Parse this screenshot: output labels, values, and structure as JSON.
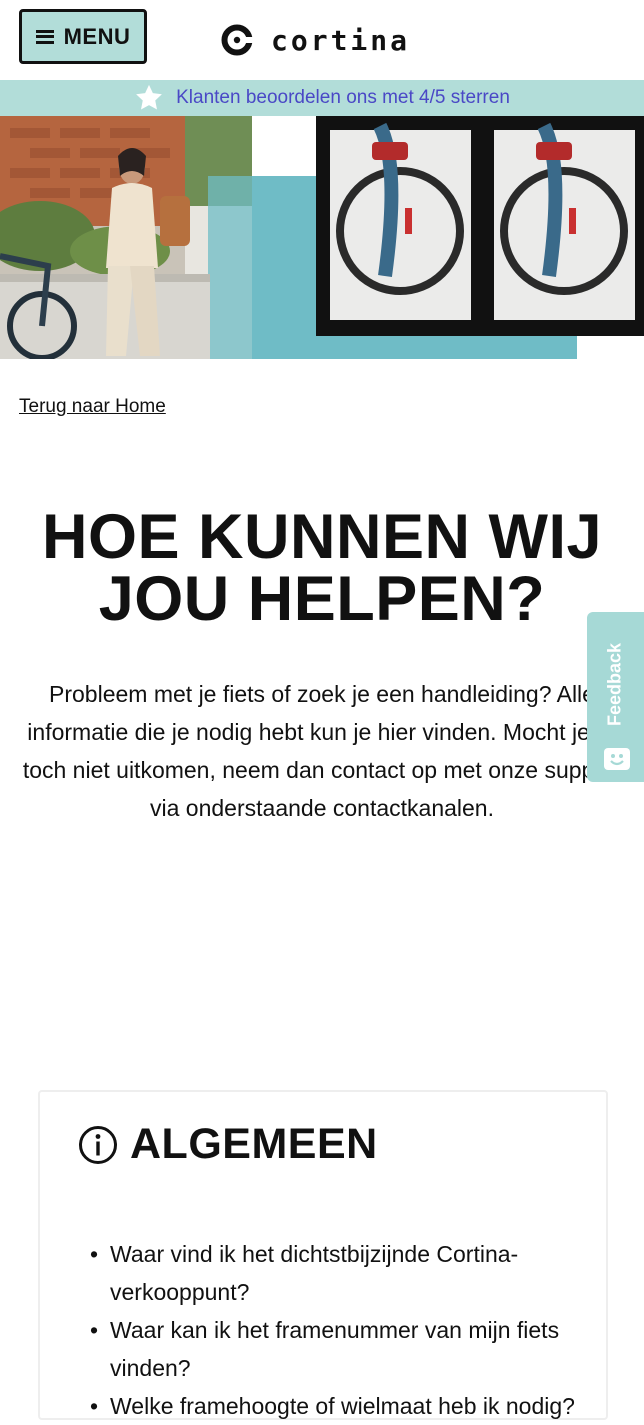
{
  "header": {
    "menu_label": "MENU",
    "logo_text": "cortina"
  },
  "rating": {
    "text": "Klanten beoordelen ons met 4/5 sterren",
    "icon": "star-icon"
  },
  "breadcrumb": {
    "back_label": "Terug naar Home"
  },
  "main": {
    "title_line1": "HOE KUNNEN WIJ",
    "title_line2": "JOU HELPEN?",
    "intro": "Probleem met je fiets of zoek je een handleiding? Alle informatie die je nodig hebt kun je hier vinden. Mocht je er toch niet uitkomen, neem dan contact op met onze support via onderstaande contactkanalen."
  },
  "feedback_tab": {
    "label": "Feedback"
  },
  "faq_card": {
    "title": "ALGEMEEN",
    "icon": "info-icon",
    "items": [
      "Waar vind ik het dichtstbijzijnde Cortina-verkooppunt?",
      "Waar kan ik het framenummer van mijn fiets vinden?",
      "Welke framehoogte of wielmaat heb ik nodig?"
    ]
  },
  "colors": {
    "mint": "#b2ddd9",
    "link_purple": "#4a48c6",
    "teal_block": "#6fbcc6",
    "feedback_tab": "#a6d9d6",
    "text": "#111111"
  }
}
